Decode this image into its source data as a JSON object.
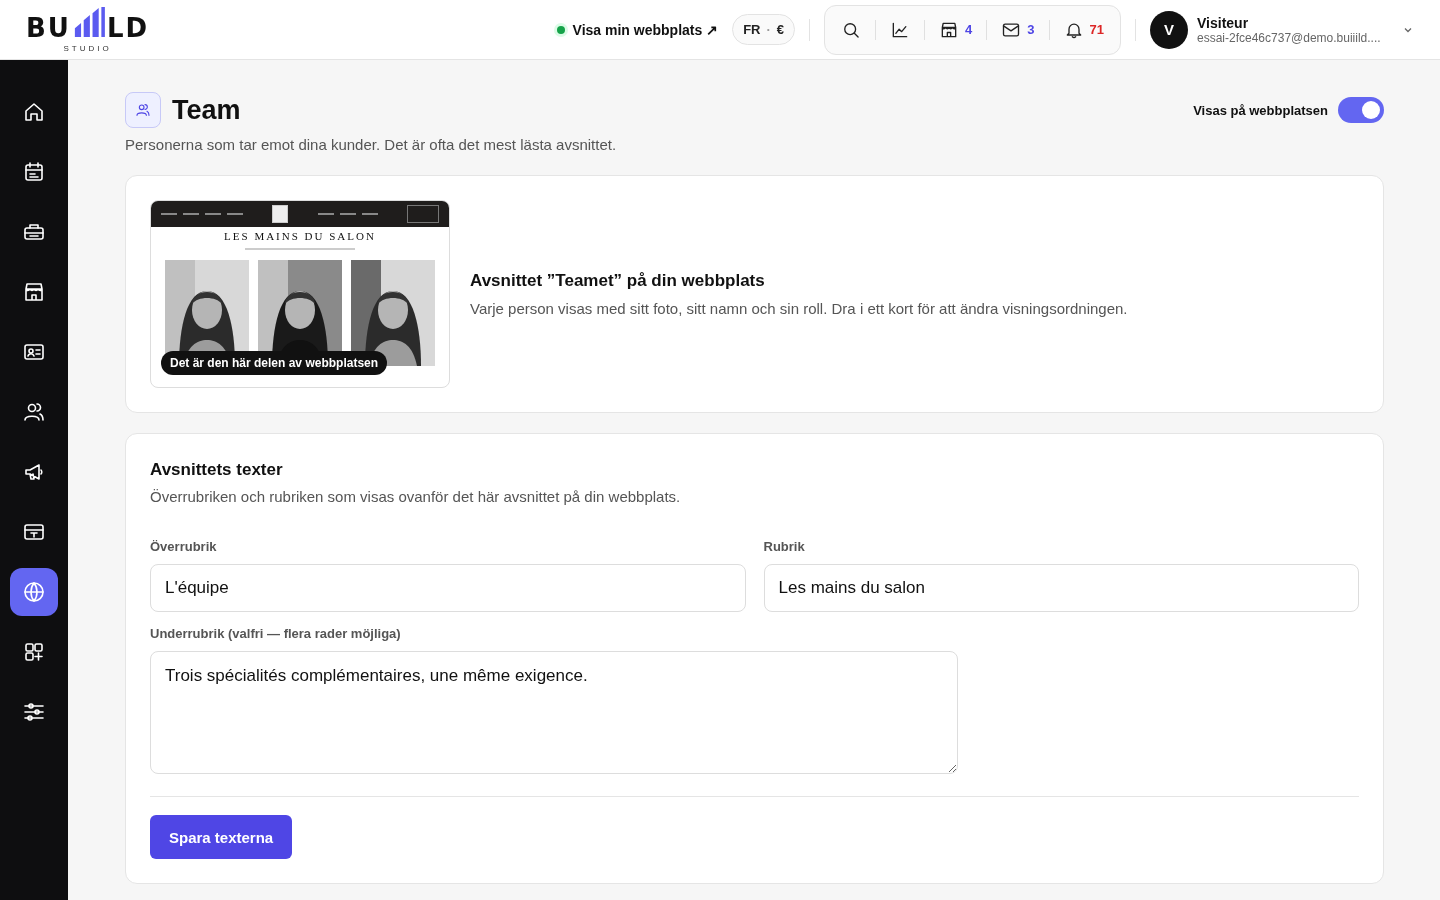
{
  "header": {
    "logo": {
      "left": "BU",
      "right": "LD",
      "tagline": "STUDIO"
    },
    "site_link": {
      "label": "Visa min webbplats ↗",
      "live": true
    },
    "locale": {
      "language": "FR",
      "separator": "·",
      "currency": "€"
    },
    "toolbar": [
      {
        "kind": "search"
      },
      {
        "kind": "chart"
      },
      {
        "kind": "store",
        "count": "4",
        "color": "#4f46e5"
      },
      {
        "kind": "mail",
        "count": "3",
        "color": "#4f46e5"
      },
      {
        "kind": "bell",
        "count": "71",
        "color": "#dc2626"
      }
    ],
    "user": {
      "initial": "V",
      "name": "Visiteur",
      "email": "essai-2fce46c737@demo.buiiild...."
    }
  },
  "sidebar": {
    "items": [
      {
        "kind": "home",
        "selected": false
      },
      {
        "kind": "calendar",
        "selected": false
      },
      {
        "kind": "toolbox",
        "selected": false
      },
      {
        "kind": "store",
        "selected": false
      },
      {
        "kind": "contact-card",
        "selected": false
      },
      {
        "kind": "users",
        "selected": false
      },
      {
        "kind": "megaphone",
        "selected": false
      },
      {
        "kind": "register",
        "selected": false
      },
      {
        "kind": "globe",
        "selected": true
      },
      {
        "kind": "apps",
        "selected": false
      },
      {
        "kind": "sliders",
        "selected": false
      }
    ]
  },
  "page": {
    "title": "Team",
    "subtitle": "Personerna som tar emot dina kunder. Det är ofta det mest lästa avsnittet.",
    "visibility": {
      "label": "Visas på webbplatsen",
      "on": true
    }
  },
  "preview_card": {
    "preview": {
      "site_title": "LES MAINS DU SALON",
      "badge": "Det är den här delen av webbplatsen"
    },
    "heading": "Avsnittet ”Teamet” på din webbplats",
    "description": "Varje person visas med sitt foto, sitt namn och sin roll. Dra i ett kort för att ändra visningsordningen."
  },
  "texts_card": {
    "heading": "Avsnittets texter",
    "description": "Överrubriken och rubriken som visas ovanför det här avsnittet på din webbplats.",
    "overline": {
      "label": "Överrubrik",
      "value": "L'équipe"
    },
    "title": {
      "label": "Rubrik",
      "value": "Les mains du salon"
    },
    "subtitle": {
      "label": "Underrubrik (valfri — flera rader möjliga)",
      "value": "Trois spécialités complémentaires, une même exigence."
    },
    "save_button": "Spara texterna"
  }
}
